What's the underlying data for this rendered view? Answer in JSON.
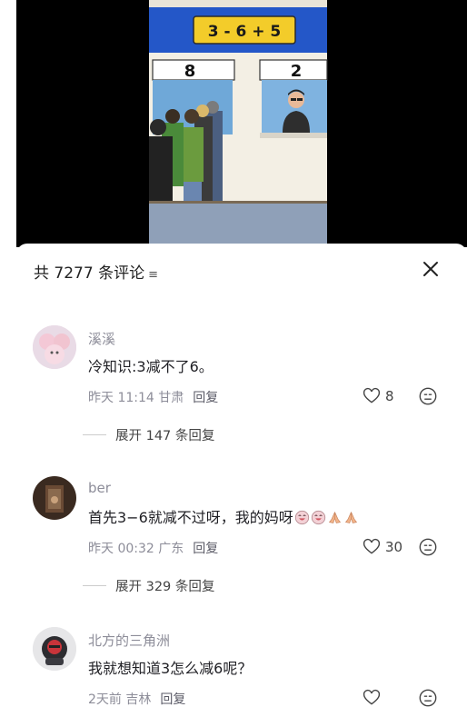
{
  "video": {
    "formula": "3 - 6 + 5",
    "window_left_number": "8",
    "window_right_number": "2"
  },
  "header": {
    "comment_count": "共 7277 条评论",
    "sort_icon": "menu-chevron-icon",
    "close_icon": "close-icon"
  },
  "comments": [
    {
      "username": "溪溪",
      "text": "冷知识:3减不了6。",
      "time_location": "昨天 11:14 甘肃",
      "reply_label": "回复",
      "likes": "8",
      "expand_label": "展开 147 条回复"
    },
    {
      "username": "ber",
      "text": "首先3−6就减不过呀，我的妈呀",
      "emojis": [
        "laughing-face",
        "laughing-face",
        "praying-hands",
        "praying-hands"
      ],
      "time_location": "昨天 00:32 广东",
      "reply_label": "回复",
      "likes": "30",
      "expand_label": "展开 329 条回复"
    },
    {
      "username": "北方的三角洲",
      "text": "我就想知道3怎么减6呢？",
      "time_location": "2天前 吉林",
      "reply_label": "回复",
      "likes": ""
    }
  ],
  "colors": {
    "billboard_blue": "#2457c8",
    "billboard_yellow": "#f3cc2a",
    "meta_gray": "#8d8d99"
  }
}
